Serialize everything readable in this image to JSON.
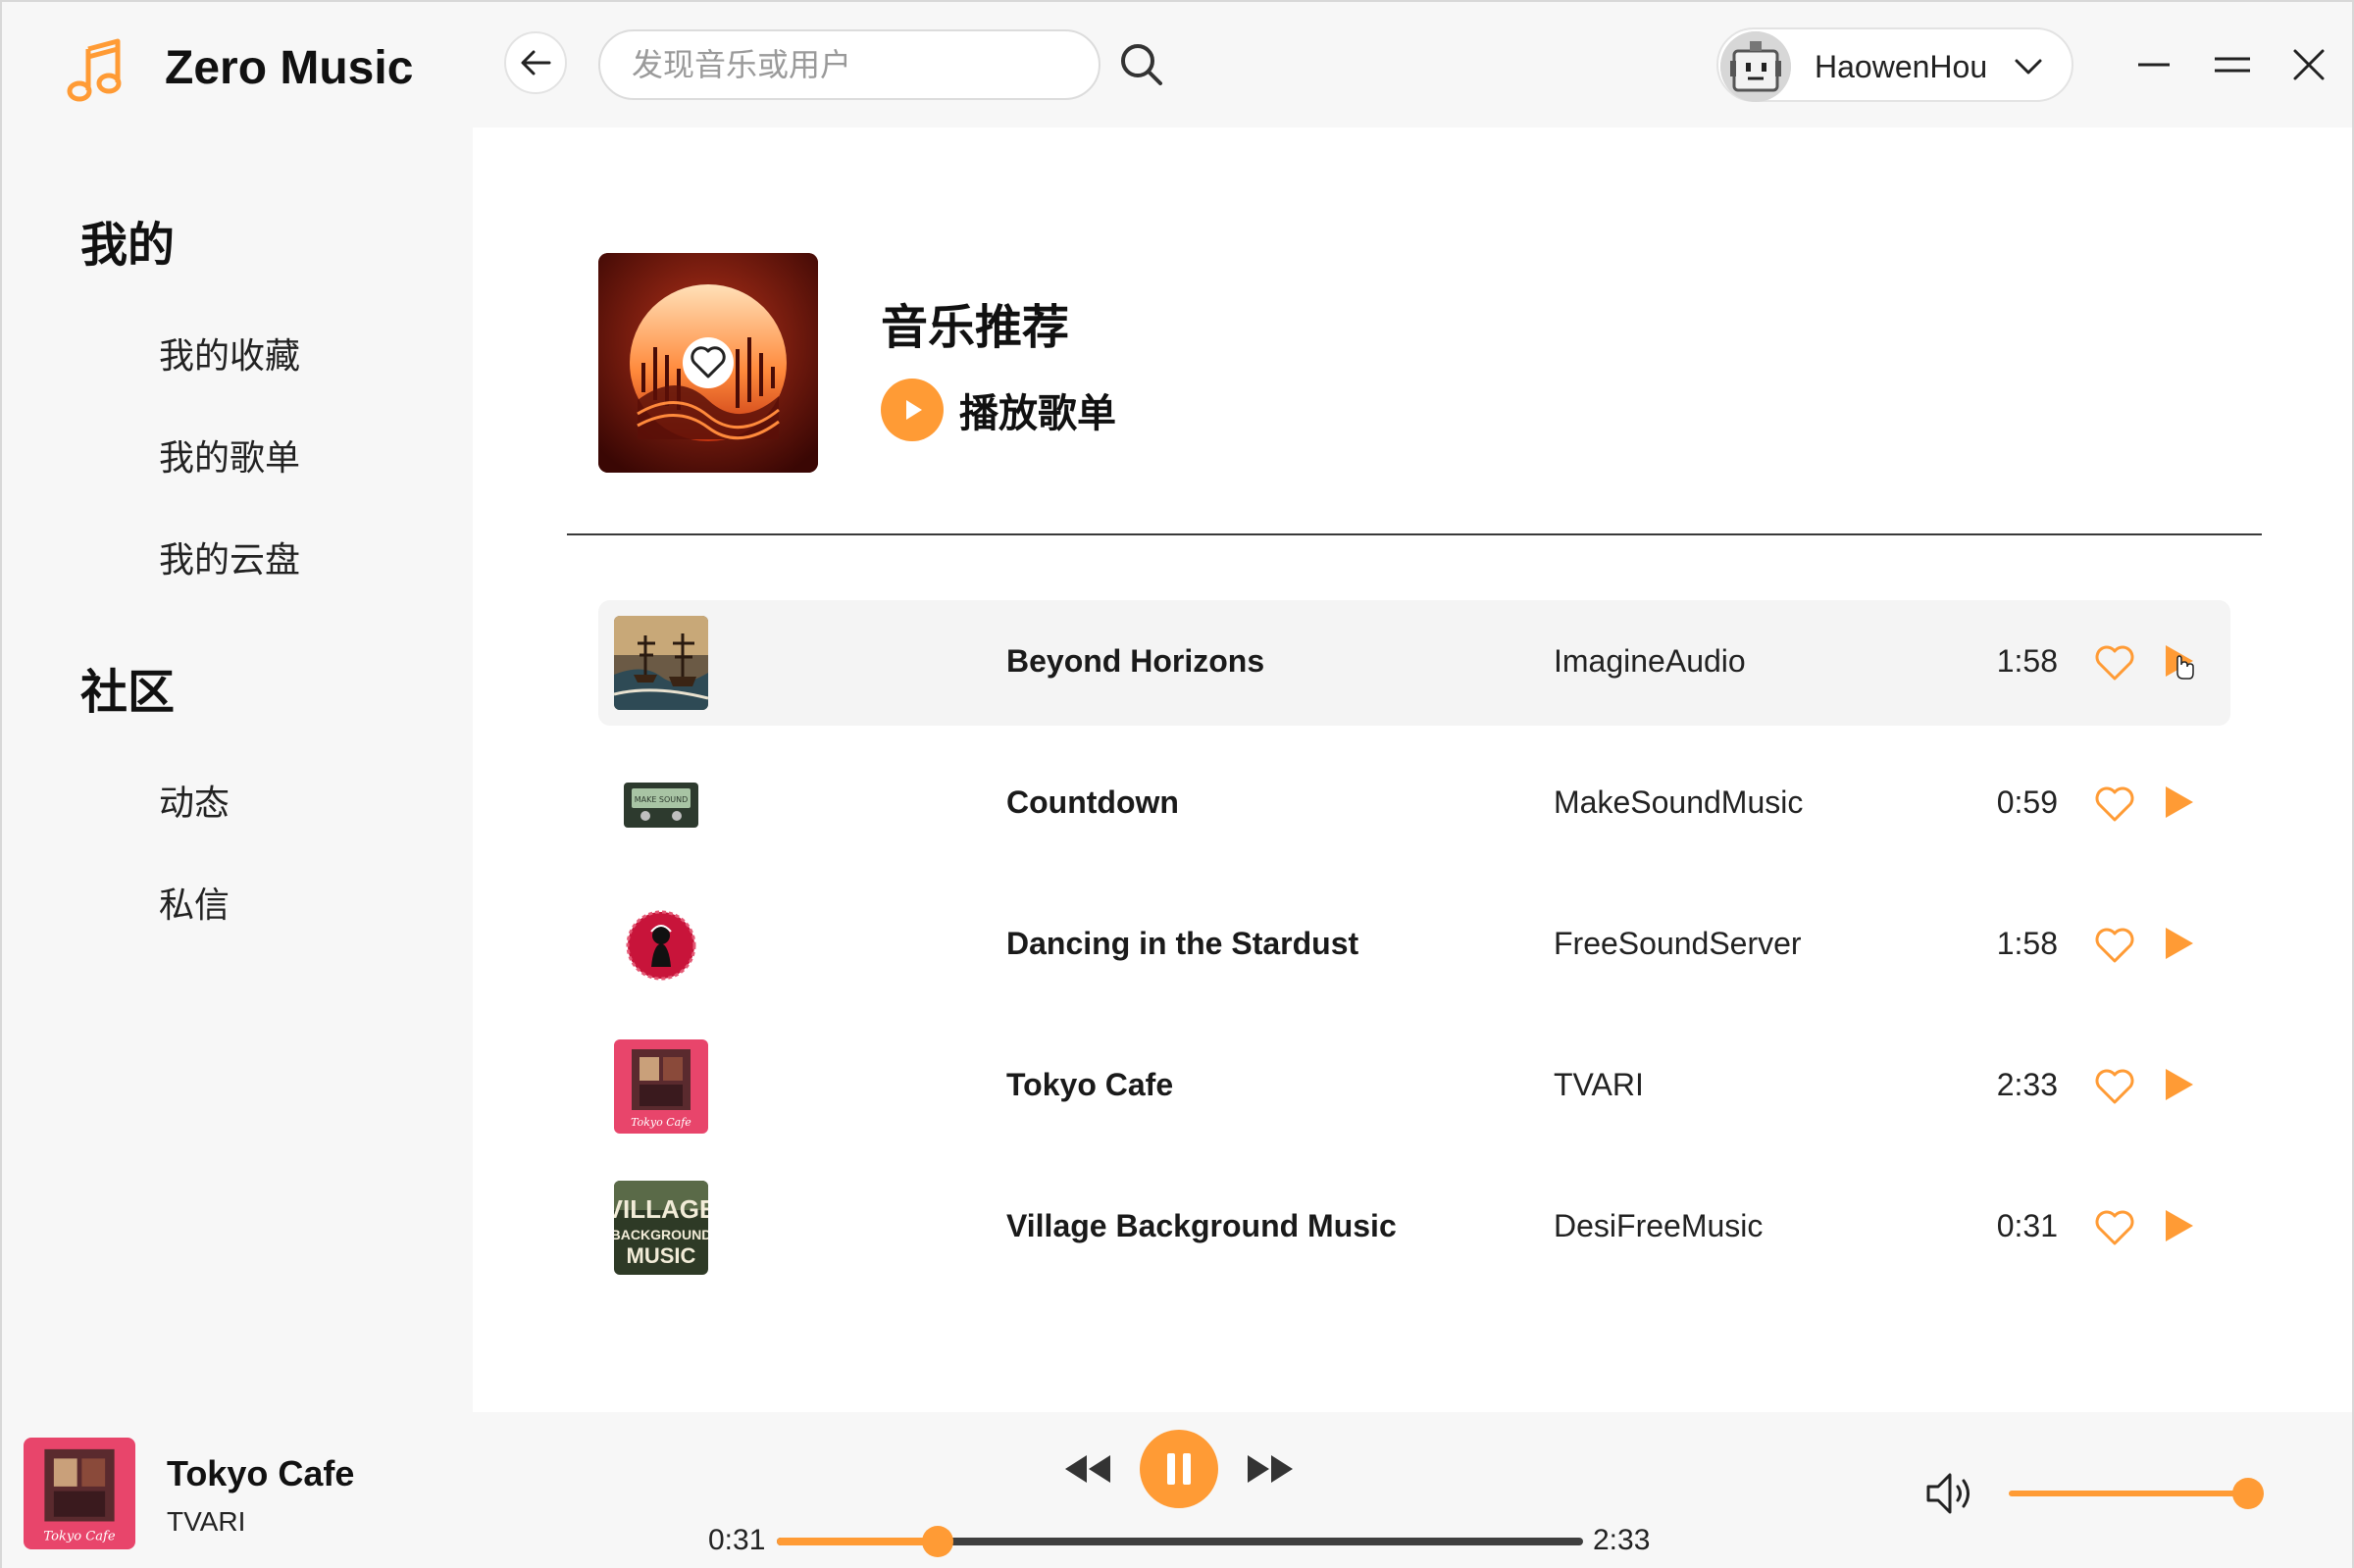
{
  "app": {
    "title": "Zero Music",
    "accent_color": "#ff9b35"
  },
  "header": {
    "back_icon": "arrow-left-icon",
    "search": {
      "placeholder": "发现音乐或用户",
      "value": ""
    },
    "search_icon": "search-icon",
    "user": {
      "name": "HaowenHou",
      "chevron_icon": "chevron-down-icon"
    },
    "window_controls": [
      "minimize-icon",
      "maximize-icon",
      "close-icon"
    ]
  },
  "sidebar": {
    "sections": [
      {
        "heading": "我的",
        "items": [
          "我的收藏",
          "我的歌单",
          "我的云盘"
        ]
      },
      {
        "heading": "社区",
        "items": [
          "动态",
          "私信"
        ]
      }
    ]
  },
  "playlist": {
    "title": "音乐推荐",
    "play_all_label": "播放歌单",
    "tracks": [
      {
        "name": "Beyond Horizons",
        "artist": "ImagineAudio",
        "duration": "1:58"
      },
      {
        "name": "Countdown",
        "artist": "MakeSoundMusic",
        "duration": "0:59"
      },
      {
        "name": "Dancing in the Stardust",
        "artist": "FreeSoundServer",
        "duration": "1:58"
      },
      {
        "name": "Tokyo Cafe",
        "artist": "TVARI",
        "duration": "2:33"
      },
      {
        "name": "Village Background Music",
        "artist": "DesiFreeMusic",
        "duration": "0:31"
      }
    ],
    "thumb_logo_texts": {
      "countdown": "MAKE SOUND",
      "tokyo_cafe": "Tokyo Cafe",
      "village": [
        "VILLAGE",
        "BACKGROUND",
        "MUSIC"
      ]
    }
  },
  "player": {
    "now_playing": {
      "title": "Tokyo Cafe",
      "artist": "TVARI"
    },
    "elapsed": "0:31",
    "total": "2:33",
    "progress_fraction": 0.2,
    "volume_fraction": 1.0,
    "icons": [
      "rewind-icon",
      "pause-icon",
      "fast-forward-icon",
      "volume-icon"
    ]
  }
}
